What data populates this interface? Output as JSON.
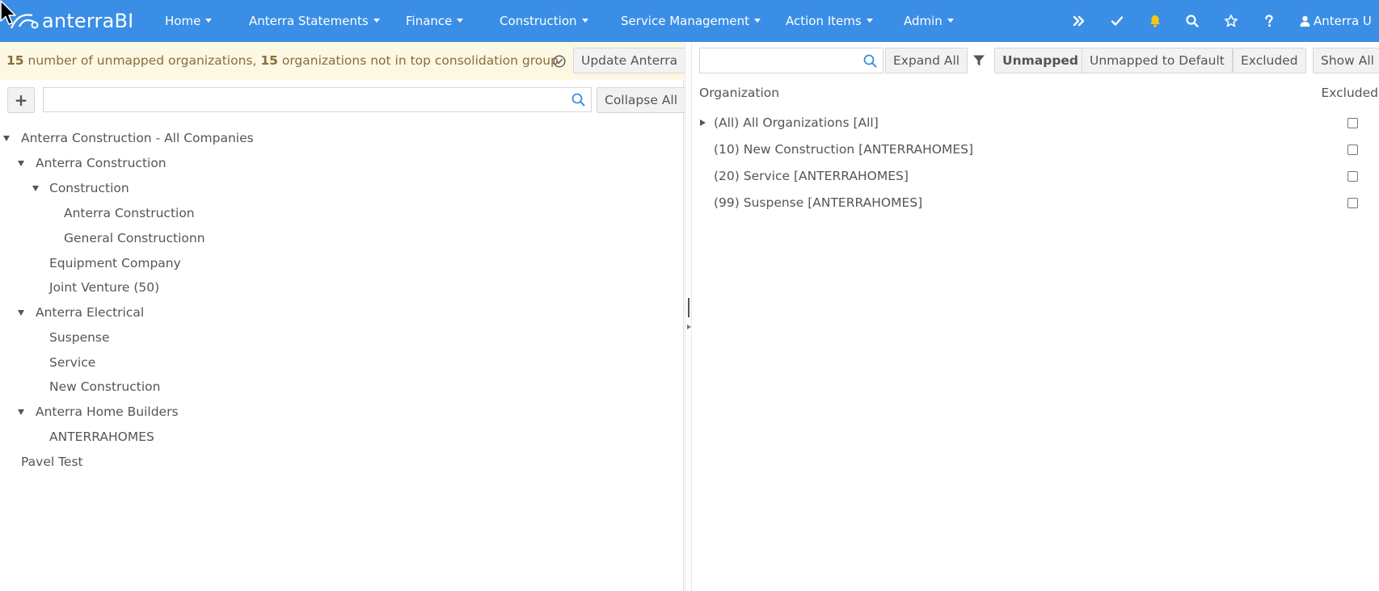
{
  "app": {
    "brand": "anterraBI",
    "user": "Anterra U"
  },
  "nav": {
    "menus": [
      "Home",
      "Anterra Statements",
      "Finance",
      "Construction",
      "Service Management",
      "Action Items",
      "Admin"
    ],
    "icons": [
      "double-chevron-right-icon",
      "check-icon",
      "bell-icon",
      "search-icon",
      "star-icon",
      "question-icon",
      "user-icon"
    ]
  },
  "alert": {
    "unmapped_count": "15",
    "unmapped_text": " number of unmapped organizations, ",
    "not_in_top_count": "15",
    "not_in_top_text": " organizations not in top consolidation group",
    "update_button": "Update Anterra"
  },
  "left_toolbar": {
    "add_button": "+",
    "search_value": "",
    "collapse_button": "Collapse All"
  },
  "tree": [
    {
      "label": "Anterra Construction - All Companies",
      "level": 0,
      "expanded": true
    },
    {
      "label": "Anterra Construction",
      "level": 1,
      "expanded": true
    },
    {
      "label": "Construction",
      "level": 2,
      "expanded": true
    },
    {
      "label": "Anterra Construction",
      "level": 3,
      "expanded": null
    },
    {
      "label": "General Constructionn",
      "level": 3,
      "expanded": null
    },
    {
      "label": "Equipment Company",
      "level": 2,
      "expanded": null
    },
    {
      "label": "Joint Venture (50)",
      "level": 2,
      "expanded": null
    },
    {
      "label": "Anterra Electrical",
      "level": 1,
      "expanded": true
    },
    {
      "label": "Suspense",
      "level": 2,
      "expanded": null
    },
    {
      "label": "Service",
      "level": 2,
      "expanded": null
    },
    {
      "label": "New Construction",
      "level": 2,
      "expanded": null
    },
    {
      "label": "Anterra Home Builders",
      "level": 1,
      "expanded": true
    },
    {
      "label": "ANTERRAHOMES",
      "level": 2,
      "expanded": null
    },
    {
      "label": "Pavel Test",
      "level": 0,
      "expanded": null
    }
  ],
  "right_toolbar": {
    "search_value": "",
    "expand_button": "Expand All",
    "unmapped_button": "Unmapped",
    "unmapped_default_button": "Unmapped to Default",
    "excluded_button": "Excluded",
    "show_all_button": "Show All"
  },
  "grid": {
    "columns": [
      "Organization",
      "Excluded"
    ],
    "rows": [
      {
        "label": "(All) All Organizations [All]",
        "expandable": true,
        "excluded": false
      },
      {
        "label": "(10) New Construction [ANTERRAHOMES]",
        "expandable": false,
        "excluded": false
      },
      {
        "label": "(20) Service [ANTERRAHOMES]",
        "expandable": false,
        "excluded": false
      },
      {
        "label": "(99) Suspense [ANTERRAHOMES]",
        "expandable": false,
        "excluded": false
      }
    ]
  },
  "colors": {
    "navbar": "#3a8ee6",
    "alert_bg": "#fcf8e3",
    "alert_text": "#8a6d3b",
    "bell": "#f5c518"
  }
}
